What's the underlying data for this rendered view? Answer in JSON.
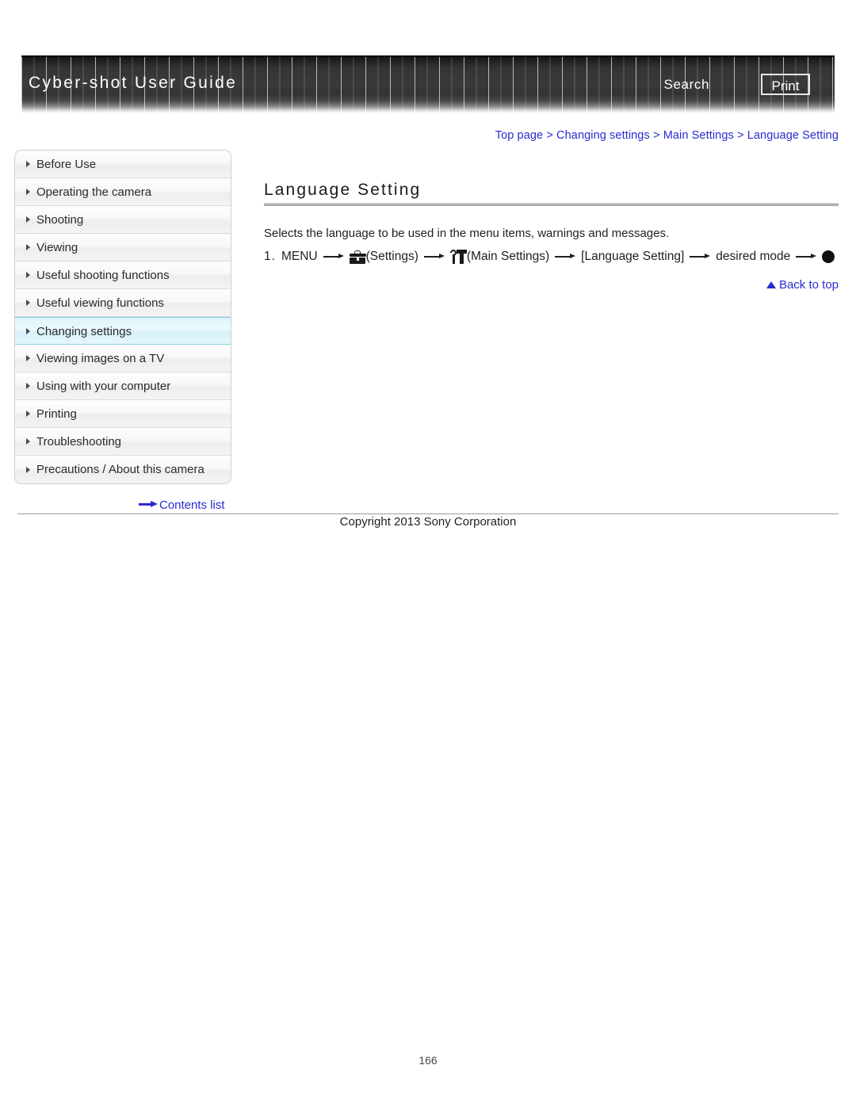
{
  "header": {
    "site_title": "Cyber-shot User Guide",
    "search_label": "Search",
    "print_label": "Print"
  },
  "breadcrumb": {
    "separator": ">",
    "items": [
      {
        "label": "Top page"
      },
      {
        "label": "Changing settings"
      },
      {
        "label": "Main Settings"
      },
      {
        "label": "Language Setting"
      }
    ]
  },
  "sidebar": {
    "items": [
      {
        "label": "Before Use",
        "active": false
      },
      {
        "label": "Operating the camera",
        "active": false
      },
      {
        "label": "Shooting",
        "active": false
      },
      {
        "label": "Viewing",
        "active": false
      },
      {
        "label": "Useful shooting functions",
        "active": false
      },
      {
        "label": "Useful viewing functions",
        "active": false
      },
      {
        "label": "Changing settings",
        "active": true
      },
      {
        "label": "Viewing images on a TV",
        "active": false
      },
      {
        "label": "Using with your computer",
        "active": false
      },
      {
        "label": "Printing",
        "active": false
      },
      {
        "label": "Troubleshooting",
        "active": false
      },
      {
        "label": "Precautions / About this camera",
        "active": false
      }
    ],
    "contents_list_label": "Contents list"
  },
  "main": {
    "title": "Language Setting",
    "intro": "Selects the language to be used in the menu items, warnings and messages.",
    "step": {
      "number": "1.",
      "menu_label": "MENU",
      "settings_label": "(Settings)",
      "main_settings_label": "(Main Settings)",
      "bracket_label": "[Language Setting]",
      "desired_mode_label": "desired mode"
    },
    "back_to_top_label": "Back to top"
  },
  "footer": {
    "copyright": "Copyright 2013 Sony Corporation",
    "page_number": "166"
  },
  "colors": {
    "link_blue": "#2a2ad0",
    "header_dark": "#333333",
    "active_nav": "#dff4fb"
  },
  "icons": {
    "settings": "toolbox-icon",
    "main_settings": "wrench-toolbox-icon",
    "confirm": "center-button-dot-icon",
    "back_to_top": "up-triangle-icon",
    "contents_arrow": "right-arrow-icon"
  }
}
